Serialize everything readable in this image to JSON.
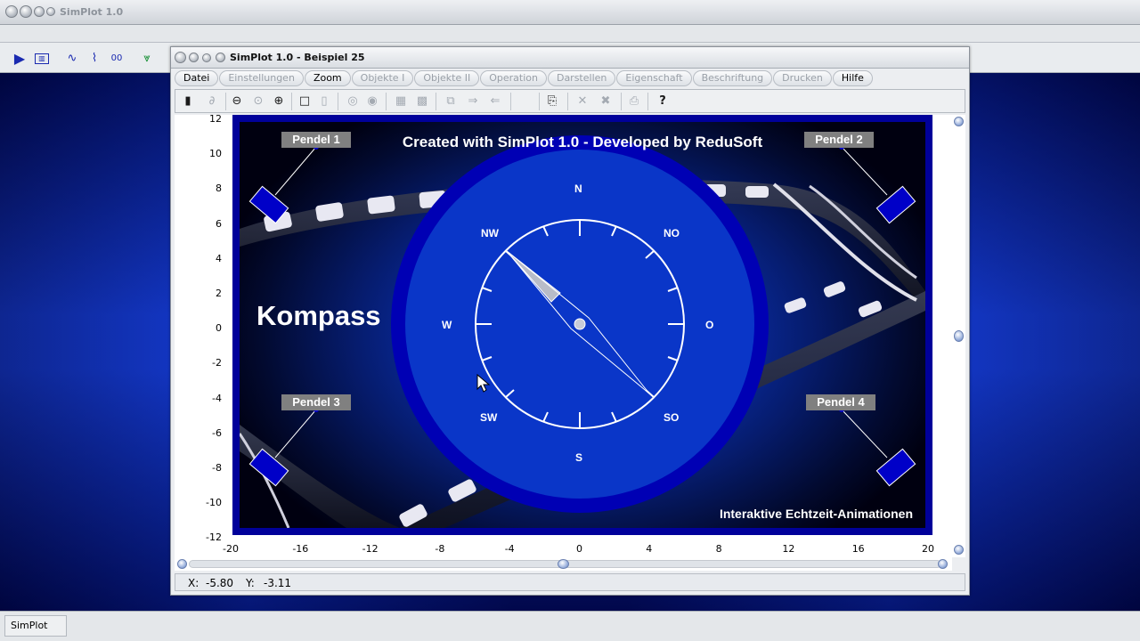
{
  "app": {
    "title": "SimPlot 1.0",
    "status_text": "SimPlot 1.0"
  },
  "document": {
    "title": "SimPlot 1.0 - Beispiel 25"
  },
  "menu": [
    {
      "label": "Datei",
      "enabled": true
    },
    {
      "label": "Einstellungen",
      "enabled": false
    },
    {
      "label": "Zoom",
      "enabled": true
    },
    {
      "label": "Objekte I",
      "enabled": false
    },
    {
      "label": "Objekte II",
      "enabled": false
    },
    {
      "label": "Operation",
      "enabled": false
    },
    {
      "label": "Darstellen",
      "enabled": false
    },
    {
      "label": "Eigenschaft",
      "enabled": false
    },
    {
      "label": "Beschriftung",
      "enabled": false
    },
    {
      "label": "Drucken",
      "enabled": false
    },
    {
      "label": "Hilfe",
      "enabled": true
    }
  ],
  "plot": {
    "y_ticks": [
      "12",
      "10",
      "8",
      "6",
      "4",
      "2",
      "0",
      "-2",
      "-4",
      "-6",
      "-8",
      "-10",
      "-12"
    ],
    "x_ticks": [
      "-20",
      "-16",
      "-12",
      "-8",
      "-4",
      "0",
      "4",
      "8",
      "12",
      "16",
      "20"
    ]
  },
  "scene": {
    "title": "Created with SimPlot 1.0 - Developed by ReduSoft",
    "heading": "Kompass",
    "footer": "Interaktive Echtzeit-Animationen",
    "pendulums": [
      "Pendel 1",
      "Pendel 2",
      "Pendel 3",
      "Pendel 4"
    ],
    "directions": {
      "n": "N",
      "no": "NO",
      "o": "O",
      "so": "SO",
      "s": "S",
      "sw": "SW",
      "w": "W",
      "nw": "NW"
    },
    "needle_heading": "NW"
  },
  "coordinates": {
    "x_label": "X:",
    "x_value": "-5.80",
    "y_label": "Y:",
    "y_value": "-3.11"
  },
  "colors": {
    "frame": "#00009a",
    "pendulum": "#0000c8",
    "label_bg": "#808080"
  }
}
